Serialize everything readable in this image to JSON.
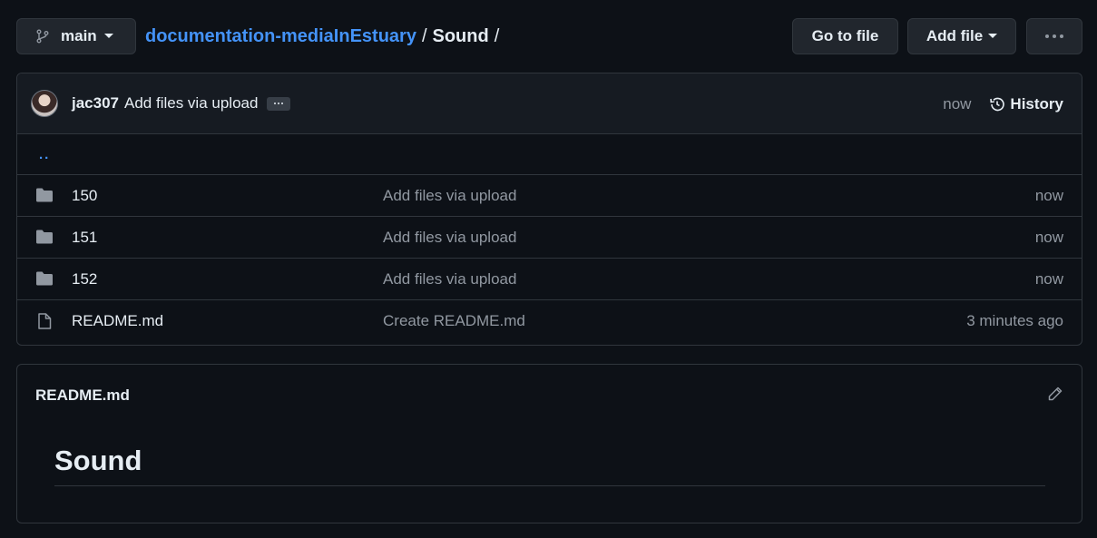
{
  "branch": {
    "label": "main",
    "icon": "git-branch-icon"
  },
  "breadcrumb": {
    "repo": "documentation-mediaInEstuary",
    "separator": "/",
    "dir": "Sound",
    "trailing": "/"
  },
  "actions": {
    "go_to_file": "Go to file",
    "add_file": "Add file",
    "more": "more-options"
  },
  "commit": {
    "author": "jac307",
    "message": "Add files via upload",
    "time": "now",
    "history_label": "History"
  },
  "parent_link": "..",
  "files": [
    {
      "type": "folder",
      "name": "150",
      "message": "Add files via upload",
      "time": "now"
    },
    {
      "type": "folder",
      "name": "151",
      "message": "Add files via upload",
      "time": "now"
    },
    {
      "type": "folder",
      "name": "152",
      "message": "Add files via upload",
      "time": "now"
    },
    {
      "type": "file",
      "name": "README.md",
      "message": "Create README.md",
      "time": "3 minutes ago"
    }
  ],
  "readme": {
    "title": "README.md",
    "heading": "Sound"
  },
  "colors": {
    "background": "#0d1117",
    "link": "#4493f8",
    "border": "#30363d",
    "muted": "#9198a1"
  }
}
